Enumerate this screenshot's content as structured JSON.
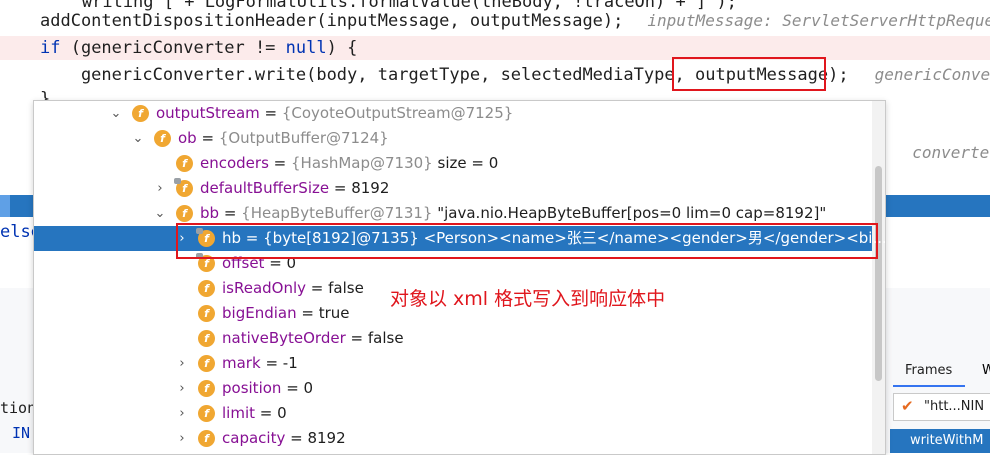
{
  "editor": {
    "line0": "        writing [ + LogFormatUtils.formatValue(theBody, !traceOn) + ]\");",
    "line1_code": "addContentDispositionHeader(inputMessage, outputMessage);",
    "line1_hint": "inputMessage: ServletServerHttpRequest",
    "line2_kw": "if",
    "line2_a": " (genericConverter != ",
    "line2_kw2": "null",
    "line2_b": ") {",
    "line3_code": "    genericConverter.write(body, targetType, selectedMediaType, outputMessage);",
    "line3_hint": "genericConverter",
    "line4": "}",
    "line5_hint": "converte",
    "line5_semi": ";",
    "line7": "else"
  },
  "popup": {
    "rows": [
      {
        "name": "outputStream",
        "obj": "{CoyoteOutputStream@7125}",
        "val": ""
      },
      {
        "name": "ob",
        "obj": "{OutputBuffer@7124}",
        "val": ""
      },
      {
        "name": "encoders",
        "obj": "{HashMap@7130}",
        "val": "size = 0"
      },
      {
        "name": "defaultBufferSize",
        "obj": "",
        "val": "8192"
      },
      {
        "name": "bb",
        "obj": "{HeapByteBuffer@7131}",
        "val": "\"java.nio.HeapByteBuffer[pos=0 lim=0 cap=8192]\""
      },
      {
        "name": "hb",
        "obj": "{byte[8192]@7135}",
        "val": "<Person><name>张三</name><gender>男</gender><bi... View"
      },
      {
        "name": "offset",
        "obj": "",
        "val": "0"
      },
      {
        "name": "isReadOnly",
        "obj": "",
        "val": "false"
      },
      {
        "name": "bigEndian",
        "obj": "",
        "val": "true"
      },
      {
        "name": "nativeByteOrder",
        "obj": "",
        "val": "false"
      },
      {
        "name": "mark",
        "obj": "",
        "val": "-1"
      },
      {
        "name": "position",
        "obj": "",
        "val": "0"
      },
      {
        "name": "limit",
        "obj": "",
        "val": "0"
      },
      {
        "name": "capacity",
        "obj": "",
        "val": "8192"
      }
    ]
  },
  "annotation": "对象以 xml 格式写入到响应体中",
  "bottom_left": {
    "line1": "tion",
    "line2": "IN"
  },
  "right_panel": {
    "tab_frames": "Frames",
    "tab_w": "W",
    "thread_text": "\"htt...NIN",
    "frame_text": "writeWithM"
  },
  "colors": {
    "selection": "#2675bf",
    "annotation": "#e0161d",
    "field_icon": "#f0a732"
  }
}
